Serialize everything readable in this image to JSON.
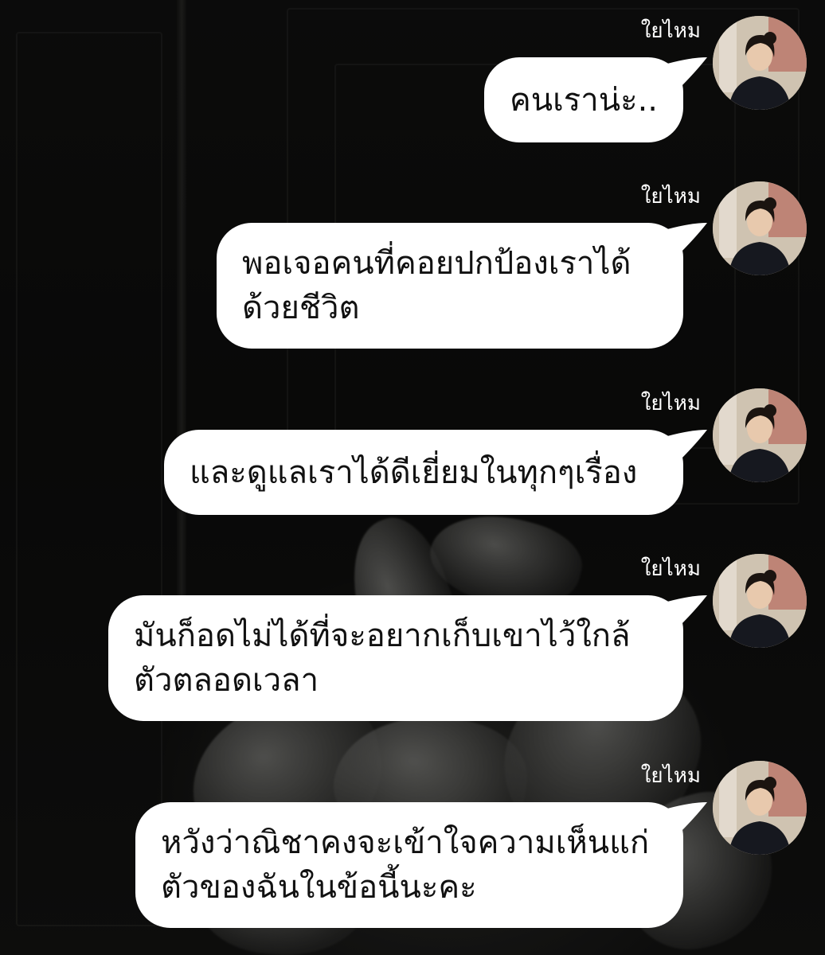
{
  "theme": {
    "bubble_color": "#ffffff",
    "text_color": "#111111",
    "sender_color": "#ffffff"
  },
  "messages": [
    {
      "sender": "ใยไหม",
      "text": "คนเราน่ะ.."
    },
    {
      "sender": "ใยไหม",
      "text": "พอเจอคนที่คอยปกป้องเราได้\nด้วยชีวิต"
    },
    {
      "sender": "ใยไหม",
      "text": "และดูแลเราได้ดีเยี่ยมในทุกๆเรื่อง"
    },
    {
      "sender": "ใยไหม",
      "text": "มันก็อดไม่ได้ที่จะอยากเก็บเขาไว้ใกล้\nตัวตลอดเวลา"
    },
    {
      "sender": "ใยไหม",
      "text": "หวังว่าณิชาคงจะเข้าใจความเห็นแก่\nตัวของฉันในข้อนี้นะคะ"
    }
  ]
}
